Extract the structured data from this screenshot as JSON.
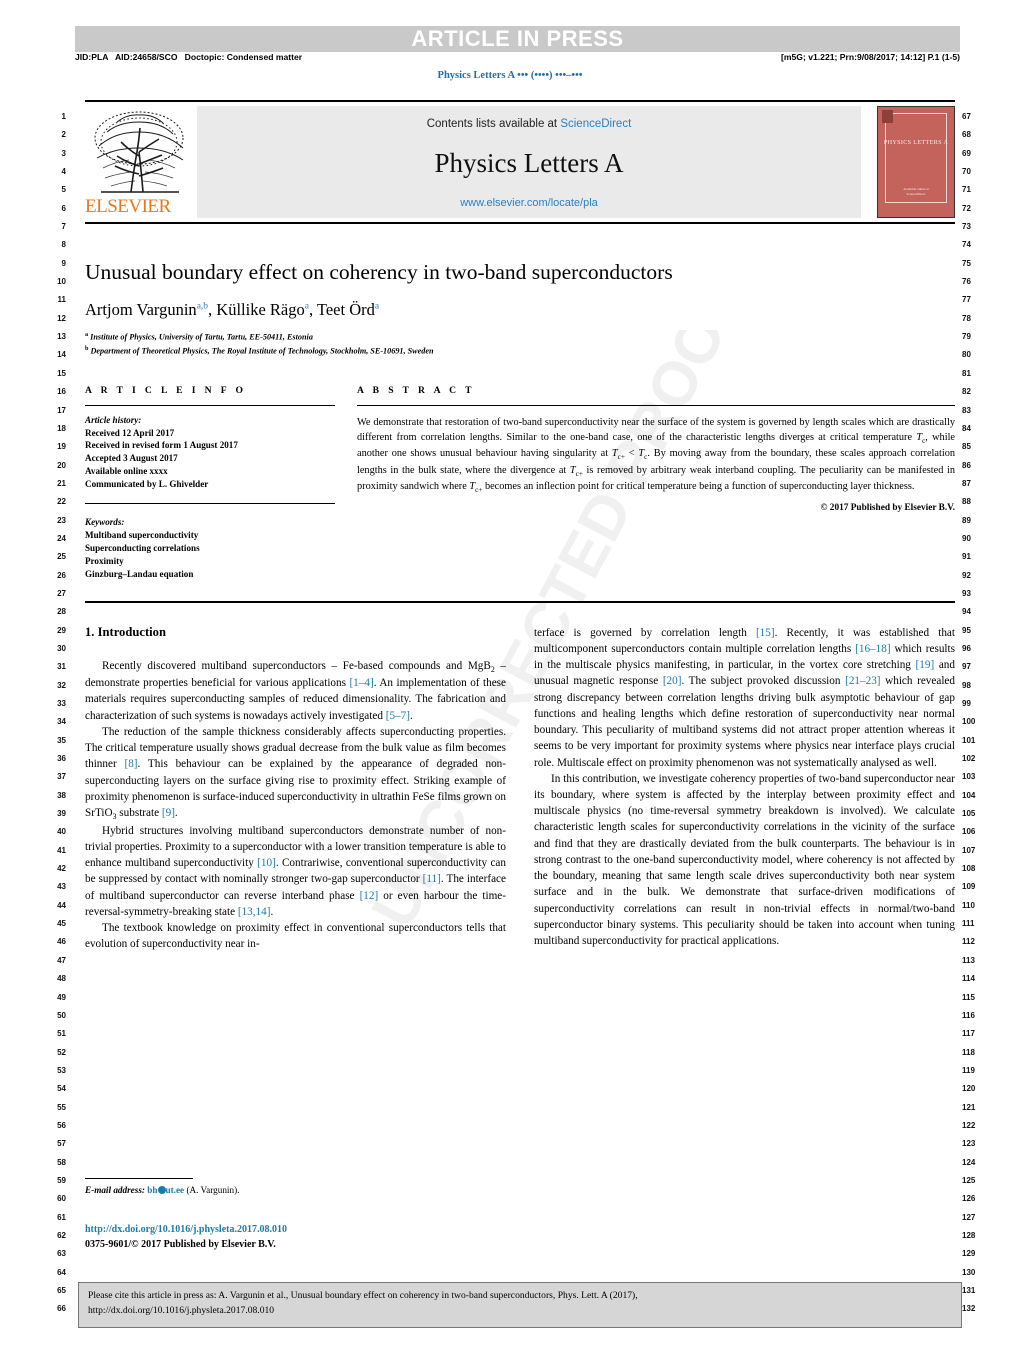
{
  "banner": {
    "text": "ARTICLE IN PRESS"
  },
  "topmeta": {
    "left": "JID:PLA   AID:24658/SCO   Doctopic: Condensed matter",
    "right": "[m5G; v1.221; Prn:9/08/2017; 14:12] P.1 (1-5)",
    "journal_running_head": "Physics Letters A ••• (••••) •••–•••"
  },
  "masthead": {
    "contents_prefix": "Contents lists available at ",
    "sciencedirect": "ScienceDirect",
    "journal_title": "Physics Letters A",
    "url": "www.elsevier.com/locate/pla",
    "publisher_logo_text": "ELSEVIER",
    "cover_title": "PHYSICS LETTERS A",
    "cover_footer": "Available online at\nScienceDirect"
  },
  "article": {
    "title": "Unusual boundary effect on coherency in two-band superconductors",
    "authors": [
      {
        "name": "Artjom Vargunin",
        "marks": "a,b"
      },
      {
        "name": "Küllike Rägo",
        "marks": "a"
      },
      {
        "name": "Teet Örd",
        "marks": "a"
      }
    ],
    "affiliations": [
      {
        "mark": "a",
        "text": "Institute of Physics, University of Tartu, Tartu, EE-50411, Estonia"
      },
      {
        "mark": "b",
        "text": "Department of Theoretical Physics, The Royal Institute of Technology, Stockholm, SE-10691, Sweden"
      }
    ]
  },
  "info": {
    "heading": "A R T I C L E    I N F O",
    "history_label": "Article history:",
    "history": [
      "Received 12 April 2017",
      "Received in revised form 1 August 2017",
      "Accepted 3 August 2017",
      "Available online xxxx",
      "Communicated by L. Ghivelder"
    ],
    "keywords_label": "Keywords:",
    "keywords": [
      "Multiband superconductivity",
      "Superconducting correlations",
      "Proximity",
      "Ginzburg–Landau equation"
    ]
  },
  "abstract": {
    "heading": "A B S T R A C T",
    "copyright": "© 2017 Published by Elsevier B.V."
  },
  "body": {
    "intro_heading": "1. Introduction",
    "footnote_label": "E-mail address:",
    "footnote_email": "bh@ut.ee",
    "footnote_attrib": "(A. Vargunin).",
    "doi": "http://dx.doi.org/10.1016/j.physleta.2017.08.010",
    "issn_line": "0375-9601/© 2017 Published by Elsevier B.V."
  },
  "cite_box": {
    "line1": "Please cite this article in press as: A. Vargunin et al., Unusual boundary effect on coherency in two-band superconductors, Phys. Lett. A (2017),",
    "line2": "http://dx.doi.org/10.1016/j.physleta.2017.08.010"
  },
  "watermark": {
    "text": "UNCORRECTED PROOF"
  },
  "line_numbers": {
    "left_start": 1,
    "left_end": 66,
    "right_start": 67,
    "right_end": 132
  },
  "colors": {
    "link": "#1d7ba8",
    "sciencedirect": "#2b7fc4",
    "elsevier_orange": "#e87722",
    "banner_bg": "#c9c9c9",
    "masthead_bg": "#eaeaea",
    "cite_bg": "#d6d6d6",
    "cover_red": "#c4625c"
  }
}
